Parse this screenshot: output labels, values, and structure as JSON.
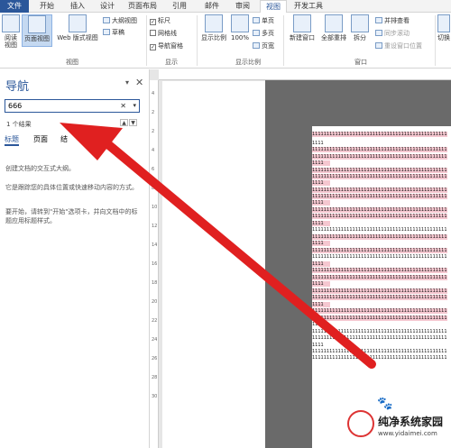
{
  "menu": {
    "items": [
      "文件",
      "开始",
      "插入",
      "设计",
      "页面布局",
      "引用",
      "邮件",
      "审阅",
      "视图",
      "开发工具"
    ],
    "active": "视图"
  },
  "ribbon": {
    "views": {
      "read_mode": "阅读视图",
      "print_layout": "页面视图",
      "web_layout": "Web 版式视图",
      "outline": "大纲视图",
      "draft": "草稿",
      "group_label": "视图"
    },
    "show": {
      "ruler": "标尺",
      "gridlines": "网格线",
      "nav_pane": "导航窗格",
      "group_label": "显示"
    },
    "zoom": {
      "zoom_btn": "显示比例",
      "hundred": "100%",
      "one_page": "单页",
      "multi_page": "多页",
      "page_width": "页宽",
      "group_label": "显示比例"
    },
    "window": {
      "new_window": "新建窗口",
      "arrange_all": "全部重排",
      "split": "拆分",
      "side_by_side": "并排查看",
      "sync_scroll": "同步滚动",
      "reset_pos": "重设窗口位置",
      "switch": "切换",
      "group_label": "窗口"
    }
  },
  "nav": {
    "title": "导航",
    "search_value": "666",
    "results": "1 个结果",
    "tabs": [
      "标题",
      "页面",
      "结"
    ],
    "hint1": "创建文档的交互式大纲。",
    "hint2": "它是跟踪您的具体位置或快速移动内容的方式。",
    "hint3": "要开始，请转到\"开始\"选项卡，并向文档中的标题应用标题样式。"
  },
  "ruler": {
    "v_ticks": [
      "4",
      "2",
      "2",
      "4",
      "6",
      "8",
      "10",
      "12",
      "14",
      "16",
      "18",
      "20",
      "22",
      "24",
      "26",
      "28",
      "30"
    ]
  },
  "document": {
    "line_text": "1111111111111111111111111111111111111111111111111111111111111111",
    "short_text": "1111"
  },
  "watermark": {
    "title": "纯净系统家园",
    "url": "www.yidaimei.com"
  }
}
